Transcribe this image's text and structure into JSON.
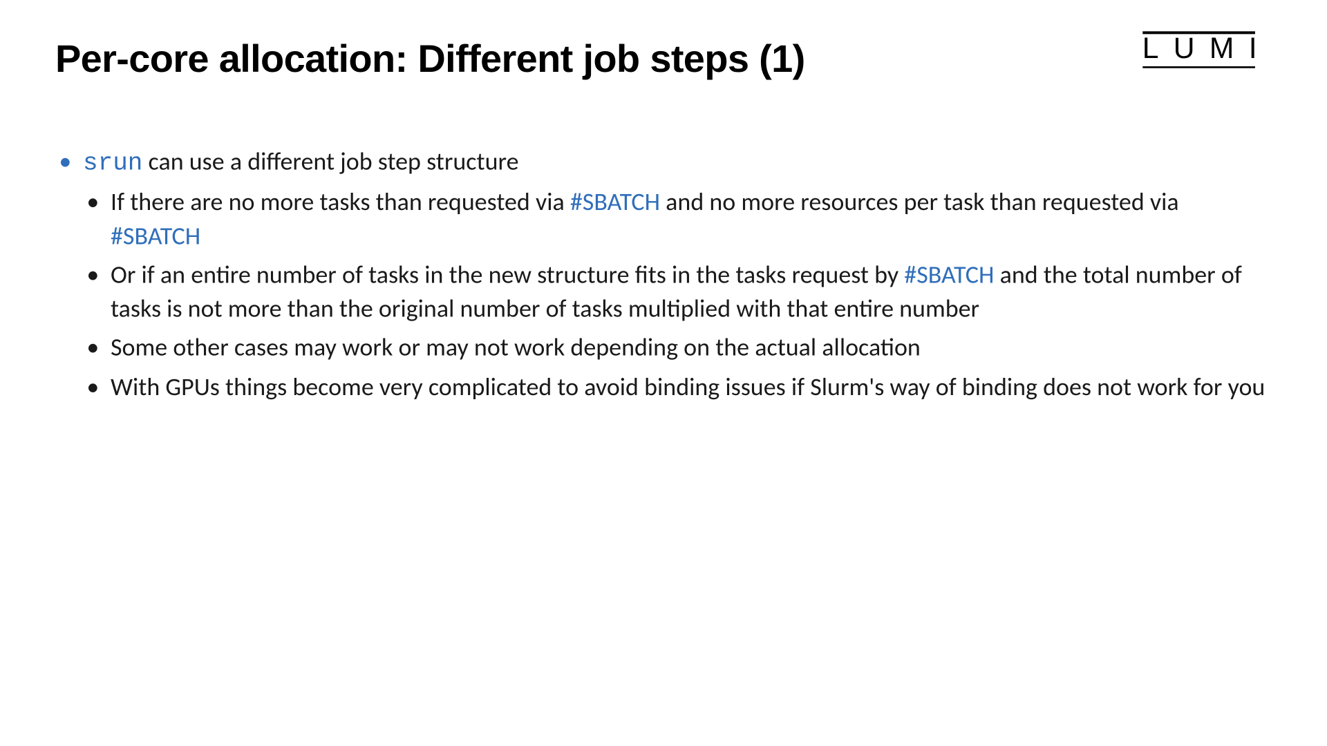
{
  "colors": {
    "accent": "#2f6eba",
    "text": "#1a1a1a"
  },
  "logo": "LUMI",
  "title": "Per-core allocation: Different job steps (1)",
  "bullet1": {
    "code": "srun",
    "rest": " can use a different job step structure",
    "sub": [
      {
        "p1": "If there are no more tasks than requested via ",
        "a1": "#SBATCH",
        "p2": " and no more resources per task than requested via ",
        "a2": "#SBATCH"
      },
      {
        "p1": "Or if an entire number of tasks in the new structure fits in the tasks request by ",
        "a1": "#SBATCH",
        "p2": " and the total number of tasks is not more than the original number of tasks multiplied with that entire number"
      },
      {
        "p1": "Some other cases may work or may not work depending on the actual allocation"
      },
      {
        "p1": "With GPUs things become very complicated to avoid binding issues if Slurm's way of binding does not work for you"
      }
    ]
  }
}
